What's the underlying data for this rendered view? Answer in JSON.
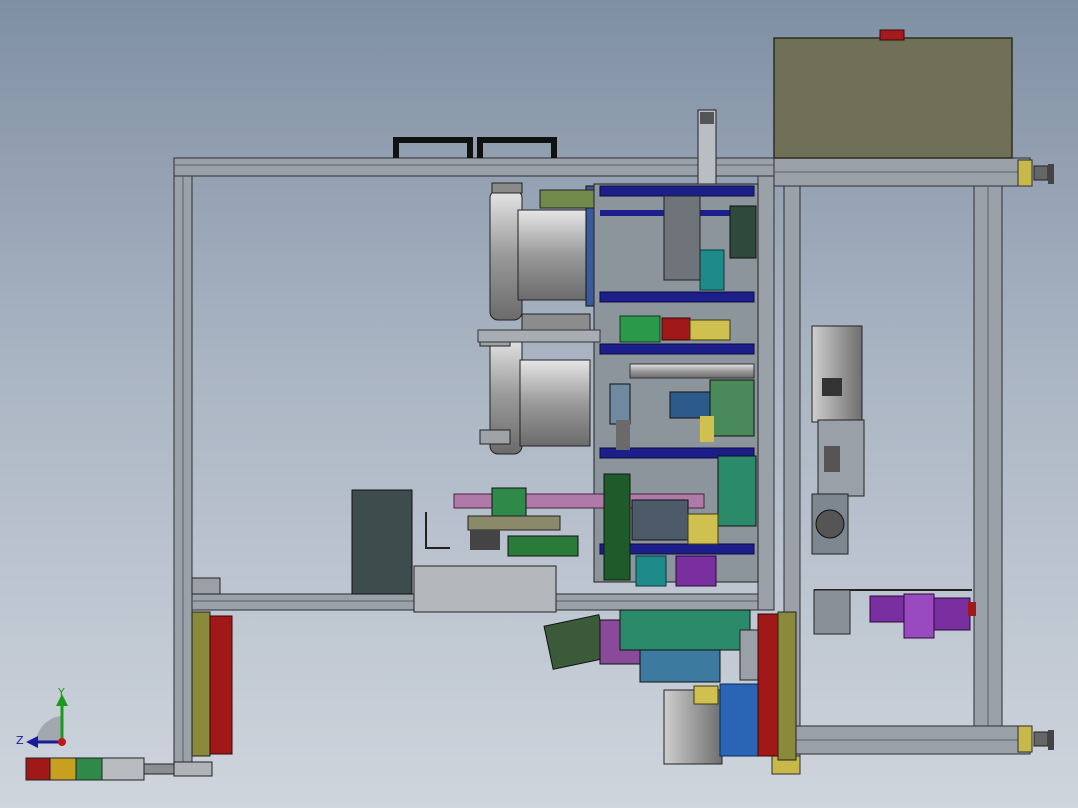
{
  "viewport": {
    "background_top": "#7f8fa3",
    "background_bottom": "#cfd5dd"
  },
  "model": {
    "frame_color": "#8d949c",
    "frame_dark": "#3c4046",
    "cabinet_color": "#6f7056",
    "accent_blue": "#1c1f8a",
    "accent_red": "#a01818",
    "accent_green": "#2f8a4a",
    "accent_purple": "#7a2fa0",
    "accent_teal": "#1f8a8a"
  },
  "triad": {
    "y_label": "Y",
    "z_label": "Z",
    "y_color": "#1a9a1a",
    "z_color": "#1a1a9a",
    "origin_color": "#c01818"
  },
  "icons": {
    "orientation_triad": "axis-triad-icon",
    "signal_tower": "signal-tower-icon"
  }
}
